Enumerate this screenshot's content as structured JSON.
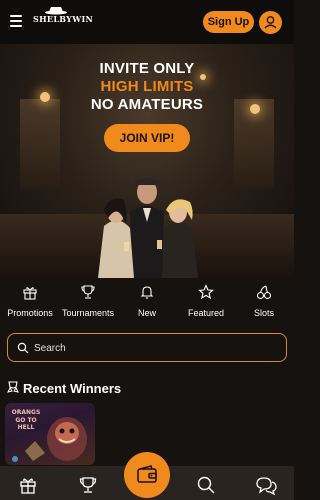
{
  "header": {
    "logo_text": "SHELBYWIN",
    "signup_label": "Sign Up"
  },
  "hero": {
    "line1": "INVITE ONLY",
    "line2": "HIGH LIMITS",
    "line3": "NO AMATEURS",
    "cta_label": "JOIN VIP!"
  },
  "categories": [
    {
      "label": "Promotions",
      "icon": "gift-icon"
    },
    {
      "label": "Tournaments",
      "icon": "trophy-icon"
    },
    {
      "label": "New",
      "icon": "bell-icon"
    },
    {
      "label": "Featured",
      "icon": "star-icon"
    },
    {
      "label": "Slots",
      "icon": "cherries-icon"
    }
  ],
  "search": {
    "placeholder": "Search"
  },
  "recent_winners": {
    "title": "Recent Winners",
    "games": [
      {
        "title": "ORANGS GO TO HELL"
      }
    ]
  },
  "bottom_nav": {
    "items": [
      "gift-icon",
      "trophy-icon",
      "wallet-icon",
      "search-icon",
      "chat-icon"
    ]
  },
  "colors": {
    "accent": "#f08a1c",
    "background": "#161210",
    "header": "#0f0d0c",
    "bottom_nav": "#2a2420"
  }
}
